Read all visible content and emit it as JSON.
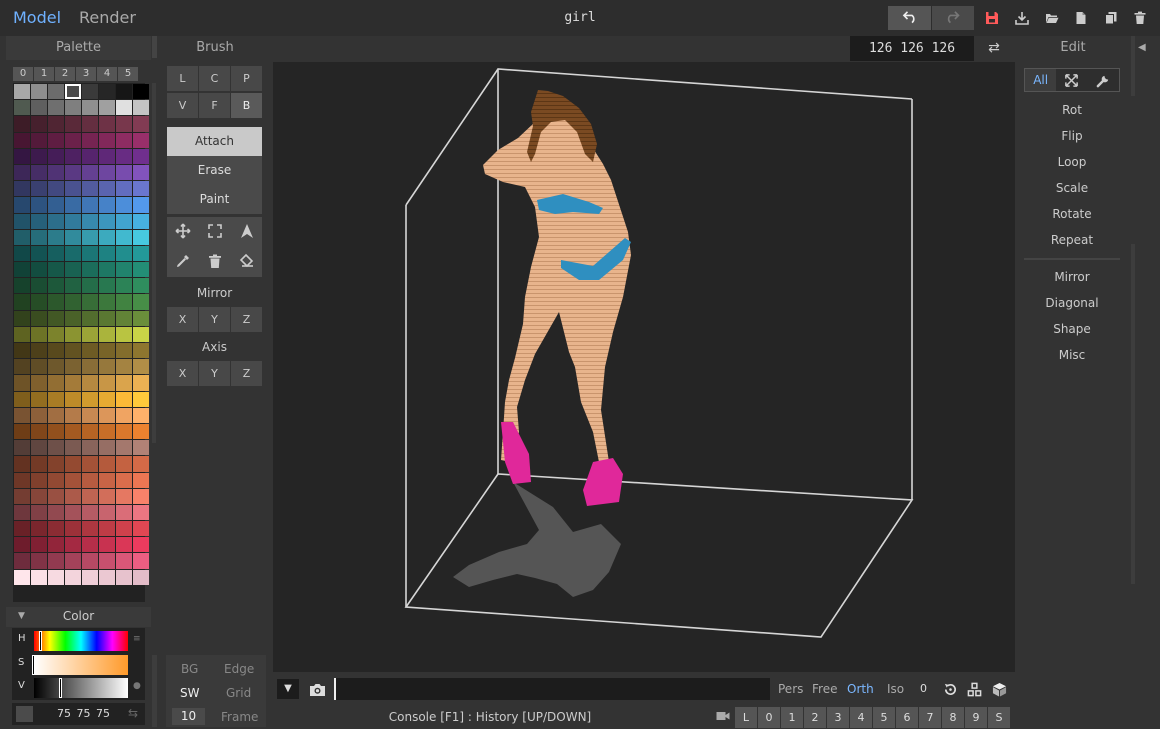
{
  "top": {
    "modes": [
      "Model",
      "Render"
    ],
    "title": "girl",
    "colors": {
      "active": "#6fb1ff",
      "save": "#ff5a5a"
    }
  },
  "palette": {
    "title": "Palette",
    "tabs": [
      "0",
      "1",
      "2",
      "3",
      "4",
      "5"
    ],
    "selected_index": 3
  },
  "color": {
    "title": "Color",
    "labels": {
      "h": "H",
      "s": "S",
      "v": "V"
    },
    "rgb": "75 75 75",
    "preview": "#4b4b4b",
    "hue": 0.07,
    "saturation": 0.0,
    "value": 0.29
  },
  "brush": {
    "title": "Brush",
    "shapes": [
      "L",
      "C",
      "P",
      "V",
      "F",
      "B"
    ],
    "active_shape": "B",
    "tools": [
      "Attach",
      "Erase",
      "Paint"
    ],
    "active_tool": "Attach",
    "action_icons": [
      "move-icon",
      "select-icon",
      "pointer-icon",
      "eyedropper-icon",
      "trash-icon",
      "bucket-icon"
    ],
    "mirror": {
      "title": "Mirror",
      "axes": [
        "X",
        "Y",
        "Z"
      ]
    },
    "axis": {
      "title": "Axis",
      "axes": [
        "X",
        "Y",
        "Z"
      ]
    },
    "bottom": {
      "bg": "BG",
      "edge": "Edge",
      "sw": "SW",
      "grid": "Grid",
      "frame_value": "10",
      "frame": "Frame"
    }
  },
  "viewport": {
    "dims": "126 126 126",
    "model_colors": {
      "skin": "#e8b48c",
      "hair": "#7a4a22",
      "bikini": "#2f8fc0",
      "shoes": "#e0289a",
      "shadow": "#555"
    }
  },
  "bottom": {
    "console_hint": "Console [F1] : History [UP/DOWN]",
    "console_value": "",
    "view_modes": [
      "Pers",
      "Free",
      "Orth",
      "Iso"
    ],
    "active_view": "Orth",
    "count": "0",
    "slots": [
      "L",
      "0",
      "1",
      "2",
      "3",
      "4",
      "5",
      "6",
      "7",
      "8",
      "9",
      "S"
    ]
  },
  "edit": {
    "title": "Edit",
    "tabs": {
      "all": "All"
    },
    "items": [
      "Rot",
      "Flip",
      "Loop",
      "Scale",
      "Rotate",
      "Repeat"
    ],
    "items2": [
      "Mirror",
      "Diagonal",
      "Shape",
      "Misc"
    ]
  }
}
